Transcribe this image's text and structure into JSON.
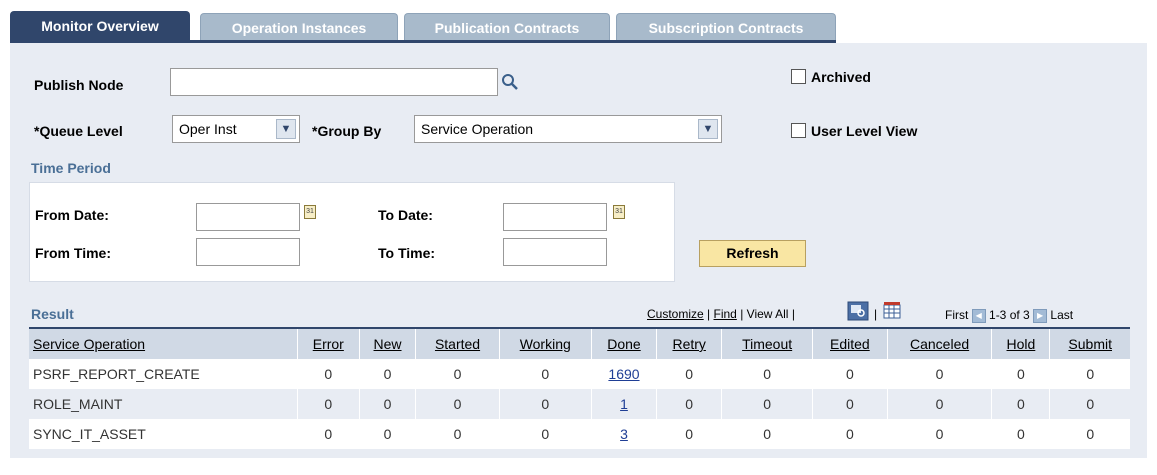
{
  "tabs": [
    {
      "label": "Monitor Overview"
    },
    {
      "label": "Operation Instances"
    },
    {
      "label": "Publication Contracts"
    },
    {
      "label": "Subscription Contracts"
    }
  ],
  "filters": {
    "publish_node_label": "Publish Node",
    "publish_node_value": "",
    "archived_label": "Archived",
    "queue_level_label": "*Queue Level",
    "queue_level_value": "Oper Inst",
    "group_by_label": "*Group By",
    "group_by_value": "Service Operation",
    "user_level_view_label": "User Level View"
  },
  "time_period": {
    "title": "Time Period",
    "from_date_label": "From Date:",
    "to_date_label": "To Date:",
    "from_time_label": "From Time:",
    "to_time_label": "To Time:",
    "calendar_glyph": "31",
    "refresh_label": "Refresh"
  },
  "result": {
    "title": "Result",
    "customize": "Customize",
    "find": "Find",
    "view_all": "View All",
    "sep": "|",
    "first": "First",
    "range": "1-3 of 3",
    "last": "Last",
    "columns": [
      "Service Operation",
      "Error",
      "New",
      "Started",
      "Working",
      "Done",
      "Retry",
      "Timeout",
      "Edited",
      "Canceled",
      "Hold",
      "Submit"
    ],
    "rows": [
      [
        "PSRF_REPORT_CREATE",
        "0",
        "0",
        "0",
        "0",
        "1690",
        "0",
        "0",
        "0",
        "0",
        "0",
        "0"
      ],
      [
        "ROLE_MAINT",
        "0",
        "0",
        "0",
        "0",
        "1",
        "0",
        "0",
        "0",
        "0",
        "0",
        "0"
      ],
      [
        "SYNC_IT_ASSET",
        "0",
        "0",
        "0",
        "0",
        "3",
        "0",
        "0",
        "0",
        "0",
        "0",
        "0"
      ]
    ]
  },
  "colors": {
    "active_tab": "#30466b",
    "inactive_tab": "#a8bacb",
    "panel": "#e8ecf3",
    "button": "#f9e6a3",
    "link": "#1f3e95"
  },
  "icons": {
    "lookup": "magnifier-icon",
    "calendar": "calendar-icon",
    "dropdown": "chevron-down-icon",
    "zoom": "zoom-icon",
    "download": "download-grid-icon"
  }
}
